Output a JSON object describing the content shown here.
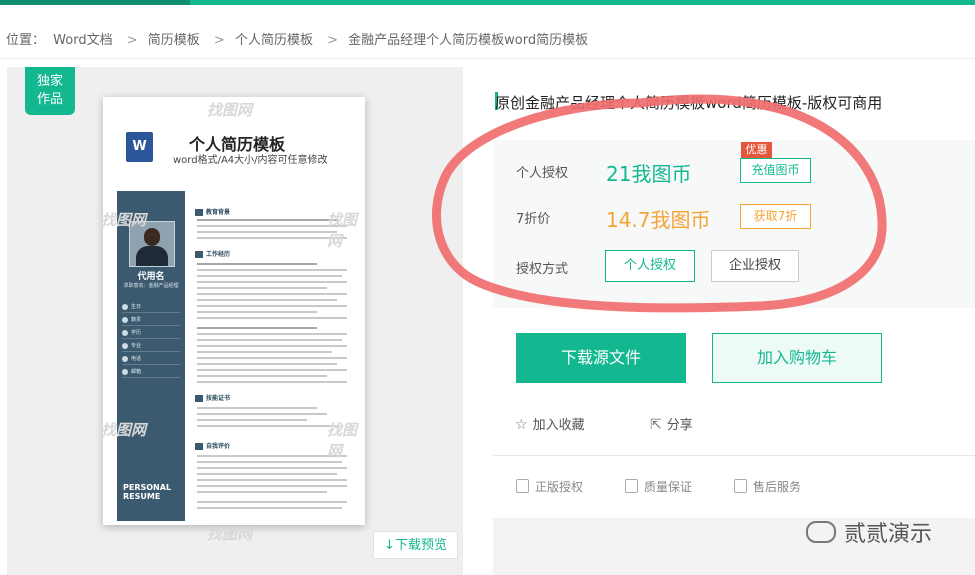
{
  "breadcrumb": {
    "prefix": "位置：",
    "items": [
      "Word文档",
      "简历模板",
      "个人简历模板",
      "金融产品经理个人简历模板word简历模板"
    ],
    "separator": ">"
  },
  "preview": {
    "badge_line1": "独家",
    "badge_line2": "作品",
    "watermark": "找图网",
    "download_preview": "下载预览",
    "resume": {
      "word_icon": "W",
      "title": "个人简历模板",
      "subtitle": "word格式/A4大小/内容可任意修改",
      "name": "代用名",
      "job": "求职意向：金融产品经理",
      "info": [
        "生日",
        "籍贯",
        "学历",
        "专业",
        "电话",
        "邮箱"
      ],
      "footer_line1": "PERSONAL",
      "footer_line2": "RESUME",
      "sections": [
        "教育背景",
        "工作经历",
        "技能证书",
        "自我评价"
      ]
    }
  },
  "product": {
    "title": "原创金融产品经理个人简历模板word简历模板-版权可商用",
    "personal_license_label": "个人授权",
    "personal_price": "21我图币",
    "promo_badge": "优惠",
    "recharge_button": "充值图币",
    "discount_label": "7折价",
    "discount_price": "14.7我图币",
    "get_discount_button": "获取7折",
    "license_type_label": "授权方式",
    "license_options": [
      "个人授权",
      "企业授权"
    ],
    "selected_license": "个人授权",
    "download_button": "下载源文件",
    "cart_button": "加入购物车",
    "favorite_label": "加入收藏",
    "share_label": "分享",
    "guarantees": [
      "正版授权",
      "质量保证",
      "售后服务"
    ]
  },
  "overlay": {
    "wechat_account": "贰贰演示"
  },
  "colors": {
    "accent": "#14b890",
    "discount": "#f5a336",
    "promo": "#e4573c",
    "annotation": "#f06e6e"
  }
}
